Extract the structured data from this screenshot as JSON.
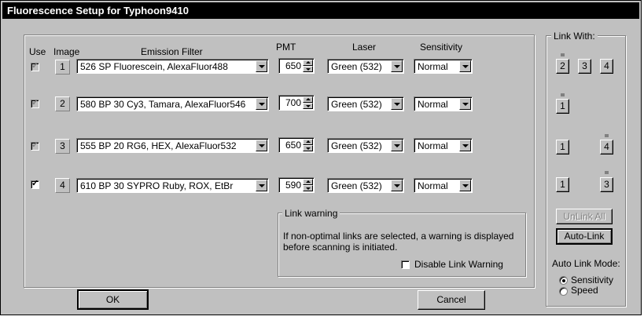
{
  "window": {
    "title": "Fluorescence Setup for Typhoon9410"
  },
  "headers": {
    "use": "Use",
    "image": "Image",
    "emission_filter": "Emission Filter",
    "pmt": "PMT",
    "laser": "Laser",
    "sensitivity": "Sensitivity"
  },
  "rows": [
    {
      "use_mark": "✓",
      "use_enabled": false,
      "image": "1",
      "filter": "526 SP Fluorescein, AlexaFluor488",
      "pmt": "650",
      "laser": "Green (532)",
      "sensitivity": "Normal"
    },
    {
      "use_mark": "✓",
      "use_enabled": false,
      "image": "2",
      "filter": "580 BP 30 Cy3, Tamara, AlexaFluor546",
      "pmt": "700",
      "laser": "Green (532)",
      "sensitivity": "Normal"
    },
    {
      "use_mark": "✓",
      "use_enabled": false,
      "image": "3",
      "filter": "555 BP 20 RG6, HEX, AlexaFluor532",
      "pmt": "650",
      "laser": "Green (532)",
      "sensitivity": "Normal"
    },
    {
      "use_mark": "✓",
      "use_enabled": true,
      "image": "4",
      "filter": "610 BP 30 SYPRO Ruby, ROX, EtBr",
      "pmt": "590",
      "laser": "Green (532)",
      "sensitivity": "Normal"
    }
  ],
  "link_warning": {
    "title": "Link warning",
    "line1": "If non-optimal links are selected, a warning is displayed",
    "line2": "before scanning is initiated.",
    "disable_label": "Disable Link Warning"
  },
  "link_with": {
    "title": "Link With:",
    "row1": [
      "2",
      "3",
      "4"
    ],
    "row2": [
      "1"
    ],
    "row3": [
      "1",
      "4"
    ],
    "row4": [
      "1",
      "3"
    ],
    "unlink_all": "UnLink All",
    "auto_link": "Auto-Link",
    "auto_link_mode_label": "Auto Link Mode:",
    "mode_sensitivity": "Sensitivity",
    "mode_speed": "Speed",
    "selected_mode": "Sensitivity"
  },
  "buttons": {
    "ok": "OK",
    "cancel": "Cancel"
  }
}
